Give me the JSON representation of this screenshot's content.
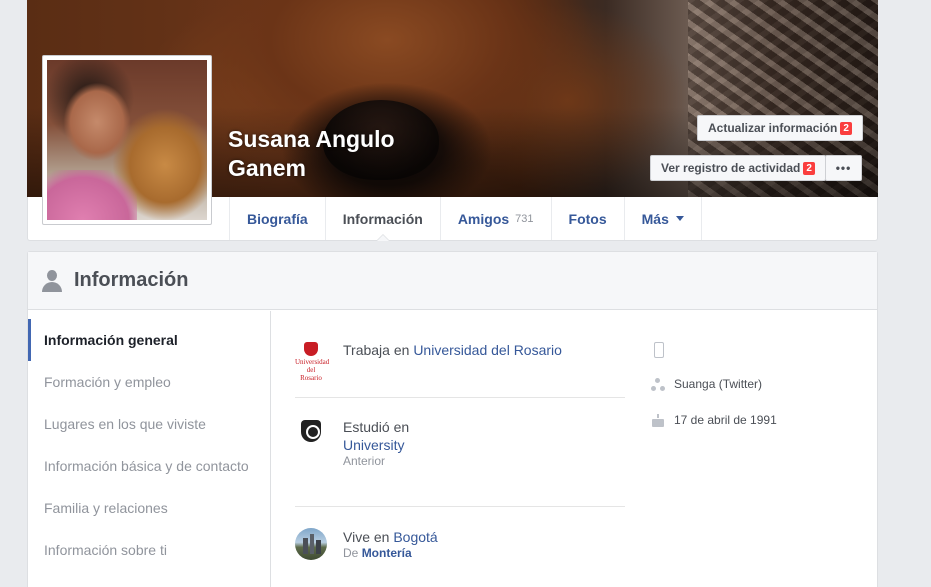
{
  "profile": {
    "name_line1": "Susana Angulo",
    "name_line2": "Ganem"
  },
  "cover_buttons": {
    "update_label": "Actualizar información",
    "update_badge": "2",
    "activity_label": "Ver registro de actividad",
    "activity_badge": "2",
    "more_label": "•••"
  },
  "tabs": [
    {
      "label": "Biografía"
    },
    {
      "label": "Información",
      "active": true
    },
    {
      "label": "Amigos",
      "count": "731"
    },
    {
      "label": "Fotos"
    },
    {
      "label": "Más"
    }
  ],
  "info_section": {
    "title": "Información"
  },
  "sidebar": {
    "items": [
      {
        "label": "Información general",
        "active": true
      },
      {
        "label": "Formación y empleo"
      },
      {
        "label": "Lugares en los que viviste"
      },
      {
        "label": "Información básica y de contacto"
      },
      {
        "label": "Familia y relaciones"
      },
      {
        "label": "Información sobre ti"
      }
    ]
  },
  "overview": {
    "work": {
      "prefix": "Trabaja en ",
      "link": "Universidad del Rosario",
      "logo_text": "Universidad del Rosario"
    },
    "study": {
      "prefix": "Estudió en ",
      "link": "University",
      "sub": "Anterior"
    },
    "lives": {
      "prefix": "Vive en ",
      "link": "Bogotá",
      "sub_prefix": "De ",
      "sub_link": "Montería"
    },
    "contact": {
      "phone": "",
      "twitter": "Suanga (Twitter)",
      "birthday": "17 de abril de 1991"
    }
  },
  "icons": {
    "info_header": "person-icon",
    "phone": "phone-icon",
    "twitter": "share-icon",
    "birthday": "cake-icon",
    "more_caret": "caret-down-icon"
  },
  "colors": {
    "link": "#365899",
    "badge": "#fa3e3e",
    "active_indicator": "#4267b2",
    "page_bg": "#e9ebee"
  }
}
